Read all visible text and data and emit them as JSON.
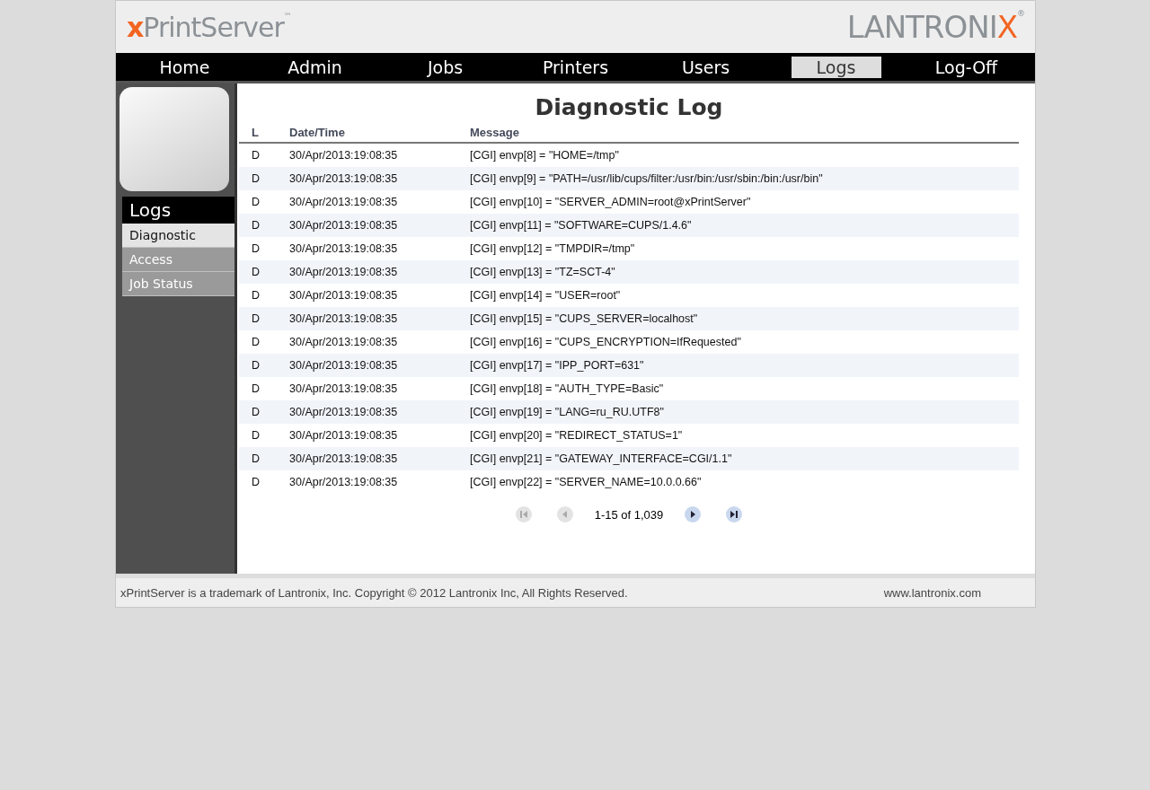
{
  "header": {
    "product_logo": {
      "prefix": "x",
      "name": "PrintServer",
      "mark": "™"
    },
    "brand_logo": {
      "name": "LANTRONI",
      "accent": "X",
      "mark": "®"
    }
  },
  "nav": [
    {
      "label": "Home",
      "selected": false
    },
    {
      "label": "Admin",
      "selected": false
    },
    {
      "label": "Jobs",
      "selected": false
    },
    {
      "label": "Printers",
      "selected": false
    },
    {
      "label": "Users",
      "selected": false
    },
    {
      "label": "Logs",
      "selected": true
    },
    {
      "label": "Log-Off",
      "selected": false
    }
  ],
  "sidebar": {
    "title": "Logs",
    "items": [
      {
        "label": "Diagnostic",
        "selected": true
      },
      {
        "label": "Access",
        "selected": false
      },
      {
        "label": "Job Status",
        "selected": false
      }
    ]
  },
  "main": {
    "title": "Diagnostic Log",
    "table": {
      "columns": [
        "L",
        "Date/Time",
        "Message"
      ],
      "rows": [
        [
          "D",
          "30/Apr/2013:19:08:35",
          "[CGI] envp[8] = \"HOME=/tmp\""
        ],
        [
          "D",
          "30/Apr/2013:19:08:35",
          "[CGI] envp[9] = \"PATH=/usr/lib/cups/filter:/usr/bin:/usr/sbin:/bin:/usr/bin\""
        ],
        [
          "D",
          "30/Apr/2013:19:08:35",
          "[CGI] envp[10] = \"SERVER_ADMIN=root@xPrintServer\""
        ],
        [
          "D",
          "30/Apr/2013:19:08:35",
          "[CGI] envp[11] = \"SOFTWARE=CUPS/1.4.6\""
        ],
        [
          "D",
          "30/Apr/2013:19:08:35",
          "[CGI] envp[12] = \"TMPDIR=/tmp\""
        ],
        [
          "D",
          "30/Apr/2013:19:08:35",
          "[CGI] envp[13] = \"TZ=SCT-4\""
        ],
        [
          "D",
          "30/Apr/2013:19:08:35",
          "[CGI] envp[14] = \"USER=root\""
        ],
        [
          "D",
          "30/Apr/2013:19:08:35",
          "[CGI] envp[15] = \"CUPS_SERVER=localhost\""
        ],
        [
          "D",
          "30/Apr/2013:19:08:35",
          "[CGI] envp[16] = \"CUPS_ENCRYPTION=IfRequested\""
        ],
        [
          "D",
          "30/Apr/2013:19:08:35",
          "[CGI] envp[17] = \"IPP_PORT=631\""
        ],
        [
          "D",
          "30/Apr/2013:19:08:35",
          "[CGI] envp[18] = \"AUTH_TYPE=Basic\""
        ],
        [
          "D",
          "30/Apr/2013:19:08:35",
          "[CGI] envp[19] = \"LANG=ru_RU.UTF8\""
        ],
        [
          "D",
          "30/Apr/2013:19:08:35",
          "[CGI] envp[20] = \"REDIRECT_STATUS=1\""
        ],
        [
          "D",
          "30/Apr/2013:19:08:35",
          "[CGI] envp[21] = \"GATEWAY_INTERFACE=CGI/1.1\""
        ],
        [
          "D",
          "30/Apr/2013:19:08:35",
          "[CGI] envp[22] = \"SERVER_NAME=10.0.0.66\""
        ]
      ]
    },
    "pager": {
      "summary": "1-15 of 1,039",
      "buttons": [
        {
          "kind": "first",
          "disabled": true
        },
        {
          "kind": "prev",
          "disabled": true
        },
        {
          "kind": "next",
          "disabled": false
        },
        {
          "kind": "last",
          "disabled": false
        }
      ]
    }
  },
  "footer": {
    "text": "xPrintServer is a trademark of Lantronix, Inc. Copyright © 2012 Lantronix Inc, All Rights Reserved.",
    "link": "www.lantronix.com"
  }
}
